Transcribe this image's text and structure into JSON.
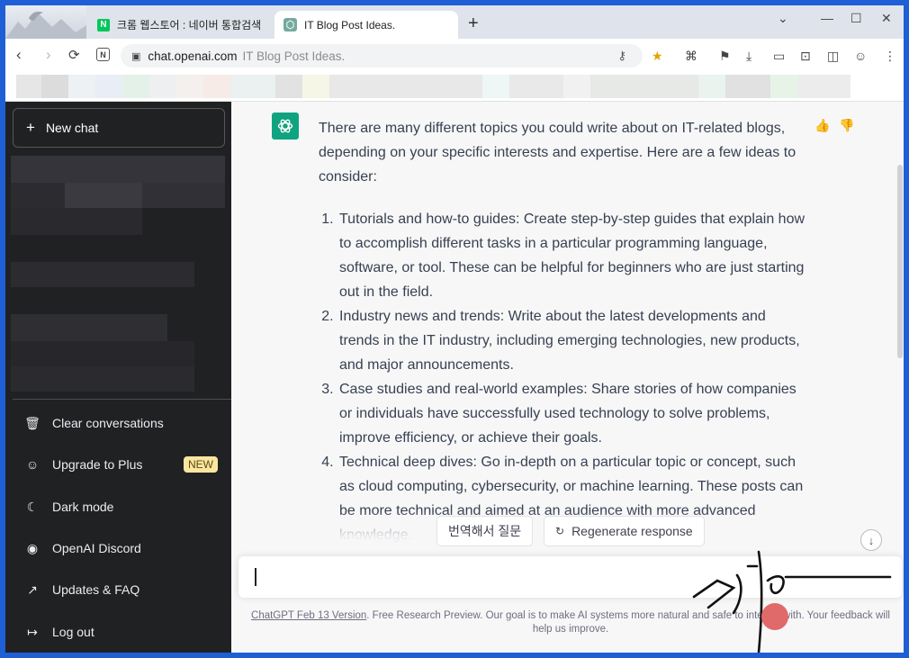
{
  "tabs": [
    {
      "title": "크롬 웹스토어 : 네이버 통합검색",
      "favicon": "N",
      "active": false
    },
    {
      "title": "IT Blog Post Ideas.",
      "active": true
    }
  ],
  "window_controls": {
    "dropdown": "⌄",
    "minimize": "—",
    "maximize": "☐",
    "close": "✕"
  },
  "address_bar": {
    "host": "chat.openai.com",
    "page_title": "IT Blog Post Ideas."
  },
  "sidebar": {
    "new_chat": "New chat",
    "items": [
      {
        "label": "Clear conversations",
        "icon": "trash-icon"
      },
      {
        "label": "Upgrade to Plus",
        "icon": "user-icon",
        "badge": "NEW"
      },
      {
        "label": "Dark mode",
        "icon": "moon-icon"
      },
      {
        "label": "OpenAI Discord",
        "icon": "discord-icon"
      },
      {
        "label": "Updates & FAQ",
        "icon": "external-link-icon"
      },
      {
        "label": "Log out",
        "icon": "logout-icon"
      }
    ]
  },
  "conversation": {
    "intro": "There are many different topics you could write about on IT-related blogs, depending on your specific interests and expertise. Here are a few ideas to consider:",
    "list": [
      "Tutorials and how-to guides: Create step-by-step guides that explain how to accomplish different tasks in a particular programming language, software, or tool. These can be helpful for beginners who are just starting out in the field.",
      "Industry news and trends: Write about the latest developments and trends in the IT industry, including emerging technologies, new products, and major announcements.",
      "Case studies and real-world examples: Share stories of how companies or individuals have successfully used technology to solve problems, improve efficiency, or achieve their goals.",
      "Technical deep dives: Go in-depth on a particular topic or concept, such as cloud computing, cybersecurity, or machine learning. These posts can be more technical and aimed at an audience with more advanced knowledge."
    ]
  },
  "actions": {
    "translate": "번역해서 질문",
    "regenerate": "Regenerate response"
  },
  "footer": {
    "version_link": "ChatGPT Feb 13 Version",
    "text": ". Free Research Preview. Our goal is to make AI systems more natural and safe to interact with. Your feedback will help us improve."
  },
  "colors": {
    "sidebar_bg": "#202123",
    "brand_green": "#10a37f",
    "main_bg": "#f7f7f8",
    "window_border": "#1f5fd6"
  }
}
